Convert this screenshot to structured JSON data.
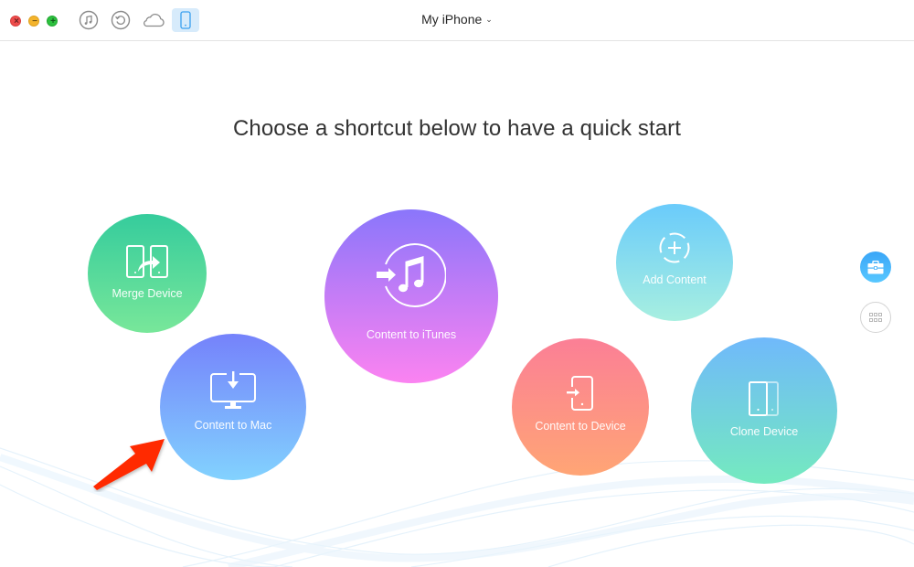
{
  "window": {
    "title": "My iPhone",
    "title_dropdown_icon": "chevron-down-icon",
    "traffic_lights": [
      {
        "name": "close",
        "symbol": "×",
        "color": "#ee4c4c"
      },
      {
        "name": "minimize",
        "symbol": "−",
        "color": "#f4b42c"
      },
      {
        "name": "maximize",
        "symbol": "+",
        "color": "#2cc13e"
      }
    ]
  },
  "toolbar": {
    "buttons": [
      {
        "name": "itunes-library",
        "icon": "music-note-icon",
        "active": false
      },
      {
        "name": "backup-restore",
        "icon": "restore-icon",
        "active": false
      },
      {
        "name": "icloud",
        "icon": "cloud-icon",
        "active": false
      },
      {
        "name": "device",
        "icon": "phone-icon",
        "active": true
      }
    ],
    "active_color": "#d7ebfb",
    "accent_color": "#3aa0ef"
  },
  "main": {
    "heading": "Choose a shortcut below to have a quick start",
    "shortcuts": [
      {
        "id": "merge-device",
        "label": "Merge Device",
        "icon": "merge-device-icon",
        "gradient": [
          "#35cc9c",
          "#78e79a"
        ]
      },
      {
        "id": "content-to-itunes",
        "label": "Content to iTunes",
        "icon": "itunes-transfer-icon",
        "gradient": [
          "#8a76fb",
          "#fb83f1"
        ]
      },
      {
        "id": "content-to-mac",
        "label": "Content to Mac",
        "icon": "mac-download-icon",
        "gradient": [
          "#7582fb",
          "#82d2fe"
        ]
      },
      {
        "id": "add-content",
        "label": "Add Content",
        "icon": "add-icon",
        "gradient": [
          "#6acbfb",
          "#a7efe0"
        ]
      },
      {
        "id": "content-to-device",
        "label": "Content to Device",
        "icon": "device-import-icon",
        "gradient": [
          "#fb7f96",
          "#ffa575"
        ]
      },
      {
        "id": "clone-device",
        "label": "Clone Device",
        "icon": "clone-device-icon",
        "gradient": [
          "#70b9fb",
          "#74eabf"
        ]
      }
    ]
  },
  "side_panel": {
    "buttons": [
      {
        "name": "toolkit",
        "icon": "briefcase-icon",
        "active": true
      },
      {
        "name": "all-categories",
        "icon": "grid-icon",
        "active": false
      }
    ]
  },
  "annotation": {
    "arrow_color": "#ff2a00",
    "points_to": "content-to-mac"
  }
}
